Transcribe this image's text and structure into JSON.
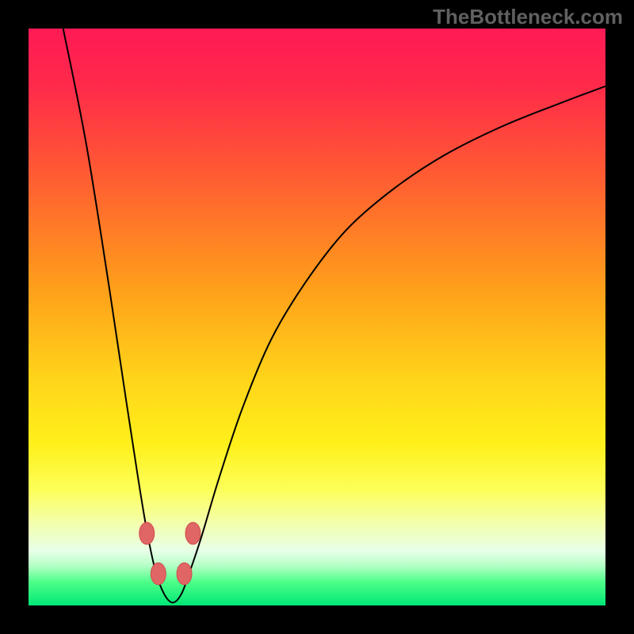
{
  "watermark": "TheBottleneck.com",
  "colors": {
    "frame": "#000000",
    "gradient_stops": [
      {
        "offset": 0.0,
        "color": "#ff1a55"
      },
      {
        "offset": 0.1,
        "color": "#ff2a4a"
      },
      {
        "offset": 0.25,
        "color": "#ff5a33"
      },
      {
        "offset": 0.45,
        "color": "#ff9f1a"
      },
      {
        "offset": 0.6,
        "color": "#ffd21a"
      },
      {
        "offset": 0.72,
        "color": "#fff01a"
      },
      {
        "offset": 0.8,
        "color": "#fdff5a"
      },
      {
        "offset": 0.86,
        "color": "#f2ffb0"
      },
      {
        "offset": 0.905,
        "color": "#e8ffe8"
      },
      {
        "offset": 0.93,
        "color": "#b8ffc8"
      },
      {
        "offset": 0.96,
        "color": "#4cff88"
      },
      {
        "offset": 1.0,
        "color": "#00e676"
      }
    ],
    "curve": "#000000",
    "marker_fill": "#e06666",
    "marker_stroke": "#d04a4a"
  },
  "chart_data": {
    "type": "line",
    "title": "",
    "xlabel": "",
    "ylabel": "",
    "xlim": [
      0,
      100
    ],
    "ylim": [
      0,
      100
    ],
    "note": "Bottleneck-style V-curve. y≈percent bottleneck; minimum near x≈25 where y≈0. Values estimated from pixel positions.",
    "series": [
      {
        "name": "bottleneck-curve",
        "x": [
          6,
          10,
          14,
          17,
          19,
          20.5,
          22,
          23.5,
          25,
          26.5,
          28,
          30,
          33,
          37,
          42,
          48,
          55,
          63,
          72,
          82,
          92,
          100
        ],
        "y": [
          100,
          80,
          55,
          35,
          22,
          13,
          6,
          2,
          0.5,
          2,
          6,
          12,
          22,
          34,
          46,
          56,
          65,
          72,
          78,
          83,
          87,
          90
        ]
      }
    ],
    "markers": {
      "name": "threshold-dots",
      "points": [
        {
          "x": 20.5,
          "y": 12.5
        },
        {
          "x": 28.5,
          "y": 12.5
        },
        {
          "x": 22.5,
          "y": 5.5
        },
        {
          "x": 27.0,
          "y": 5.5
        }
      ],
      "rx": 1.3,
      "ry": 1.9
    }
  }
}
